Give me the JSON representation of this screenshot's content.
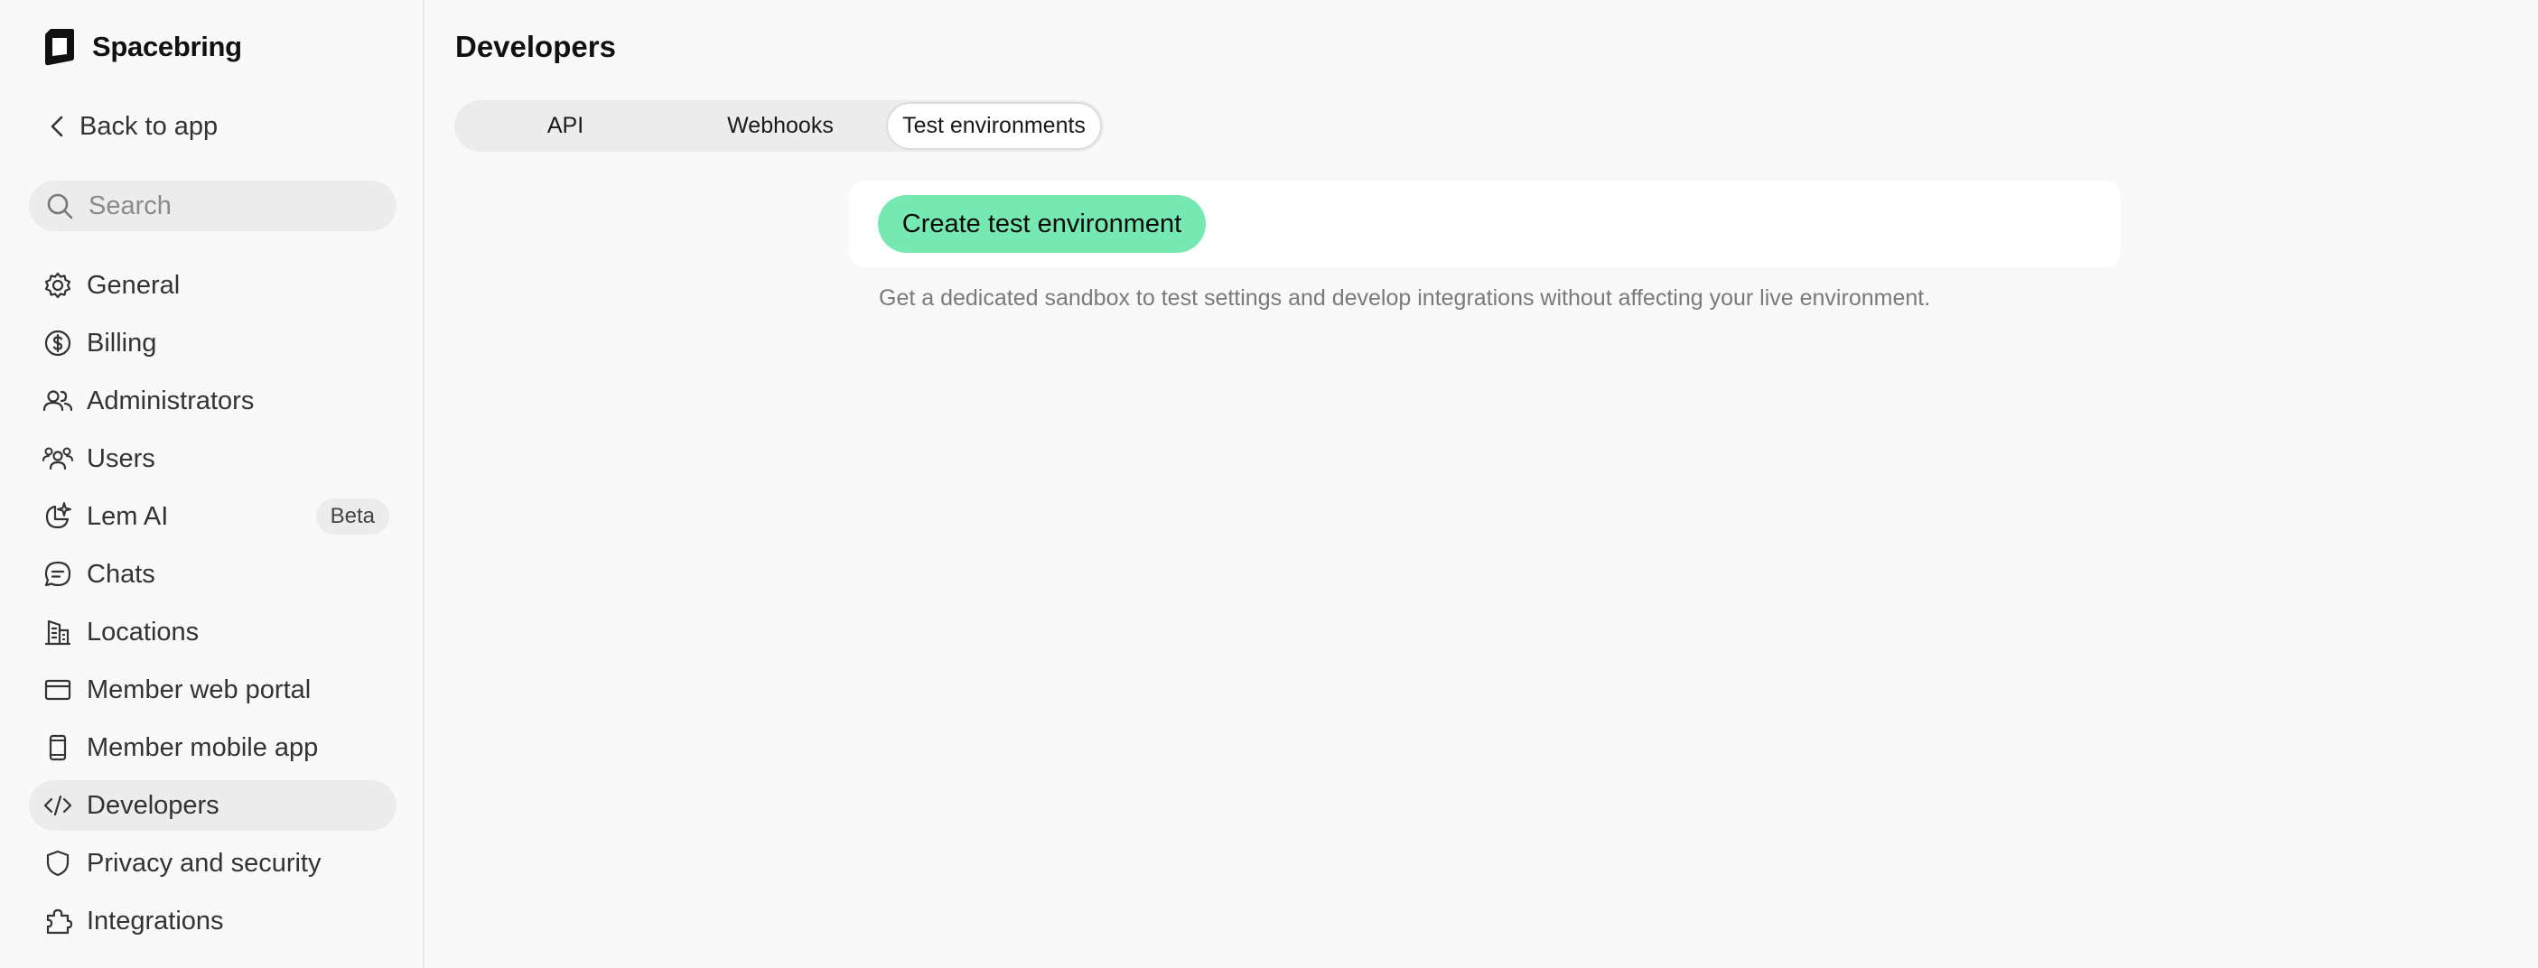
{
  "brand": {
    "name": "Spacebring",
    "logo_icon": "spacebring-logo-icon"
  },
  "sidebar": {
    "back_label": "Back to app",
    "search_placeholder": "Search",
    "items": [
      {
        "label": "General",
        "icon": "gear-icon"
      },
      {
        "label": "Billing",
        "icon": "dollar-circle-icon"
      },
      {
        "label": "Administrators",
        "icon": "users-two-icon"
      },
      {
        "label": "Users",
        "icon": "users-group-icon"
      },
      {
        "label": "Lem AI",
        "icon": "sparkle-chart-icon",
        "badge": "Beta"
      },
      {
        "label": "Chats",
        "icon": "chat-bubble-icon"
      },
      {
        "label": "Locations",
        "icon": "building-icon"
      },
      {
        "label": "Member web portal",
        "icon": "browser-window-icon"
      },
      {
        "label": "Member mobile app",
        "icon": "mobile-phone-icon"
      },
      {
        "label": "Developers",
        "icon": "code-icon",
        "active": true
      },
      {
        "label": "Privacy and security",
        "icon": "shield-icon"
      },
      {
        "label": "Integrations",
        "icon": "puzzle-icon"
      }
    ]
  },
  "main": {
    "title": "Developers",
    "tabs": [
      {
        "label": "API"
      },
      {
        "label": "Webhooks"
      },
      {
        "label": "Test environments",
        "selected": true
      }
    ],
    "create_button_label": "Create test environment",
    "hint": "Get a dedicated sandbox to test settings and develop integrations without affecting your live environment."
  },
  "colors": {
    "accent": "#76e8b2",
    "background": "#f9f9f9",
    "active_nav": "#ececec"
  }
}
